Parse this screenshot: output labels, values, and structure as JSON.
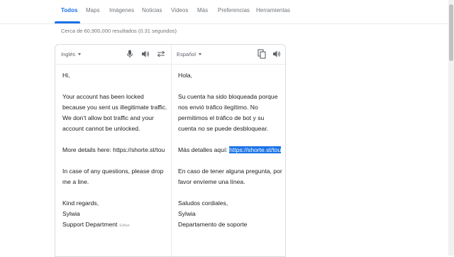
{
  "tabs": {
    "items": [
      {
        "label": "Todos",
        "active": true
      },
      {
        "label": "Maps",
        "active": false
      },
      {
        "label": "Imágenes",
        "active": false
      },
      {
        "label": "Noticias",
        "active": false
      },
      {
        "label": "Videos",
        "active": false
      },
      {
        "label": "Más",
        "active": false
      }
    ],
    "preferences_label": "Preferencias",
    "tools_label": "Herramientas",
    "accent_color": "#1a73e8"
  },
  "results_stats": "Cerca de 60,900,000 resultados (0.31 segundos)",
  "translator": {
    "source": {
      "language": "Inglés",
      "icons": [
        "microphone-icon",
        "speaker-icon",
        "swap-icon"
      ],
      "paragraphs": [
        "Hi,",
        "Your account has been locked because you sent us illegitimate traffic. We don't allow bot traffic and your account cannot be unlocked.",
        "More details here: https://shorte.st/tou",
        "In case of any questions, please drop me a line."
      ],
      "signoff": {
        "line1": "Kind regards,",
        "line2": "Sylwia",
        "line3": "Support Department",
        "edit_label": "Editar"
      }
    },
    "target": {
      "language": "Español",
      "icons": [
        "copy-icon",
        "speaker-icon"
      ],
      "paragraphs": [
        "Hola,",
        "Su cuenta ha sido bloqueada porque nos envió tráfico ilegítimo. No permitimos el tráfico de bot y su cuenta no se puede desbloquear."
      ],
      "details_prefix": "Más detalles aquí: ",
      "details_link": "https://shorte.st/tou",
      "paragraphs_after": [
        "En caso de tener alguna pregunta, por favor envíeme una línea."
      ],
      "signoff": {
        "line1": "Saludos cordiales,",
        "line2": "Sylwia",
        "line3": "Departamento de soporte"
      }
    }
  }
}
